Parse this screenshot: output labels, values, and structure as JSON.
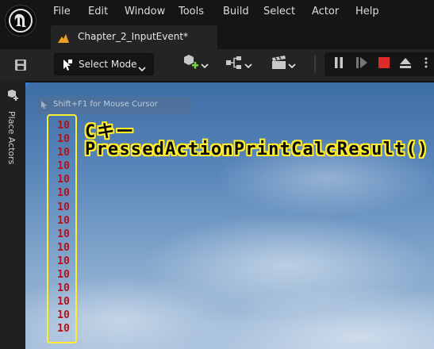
{
  "menu": [
    "File",
    "Edit",
    "Window",
    "Tools",
    "Build",
    "Select",
    "Actor",
    "Help"
  ],
  "tab": {
    "label": "Chapter_2_InputEvent*"
  },
  "toolbar": {
    "select_mode_label": "Select Mode"
  },
  "sidebar": {
    "place_actors_label": "Place Actors"
  },
  "viewport": {
    "hint": "Shift+F1 for Mouse Cursor",
    "log_lines": [
      "10",
      "10",
      "10",
      "10",
      "10",
      "10",
      "10",
      "10",
      "10",
      "10",
      "10",
      "10",
      "10",
      "10",
      "10",
      "10"
    ],
    "caption_line1": "Cキー",
    "caption_line2": "PressedActionPrintCalcResult()"
  },
  "colors": {
    "log_text": "#b5101a",
    "highlight": "#ffed2e",
    "stop_button": "#e02a2a",
    "tab_icon": "#f0a020"
  },
  "icons": [
    "unreal-logo-icon",
    "level-tab-icon",
    "save-icon",
    "select-mode-icon",
    "add-actor-icon",
    "blueprint-icon",
    "cinematics-icon",
    "pause-icon",
    "frame-skip-icon",
    "stop-icon",
    "eject-icon",
    "more-options-icon",
    "place-actors-icon",
    "mouse-cursor-icon"
  ]
}
